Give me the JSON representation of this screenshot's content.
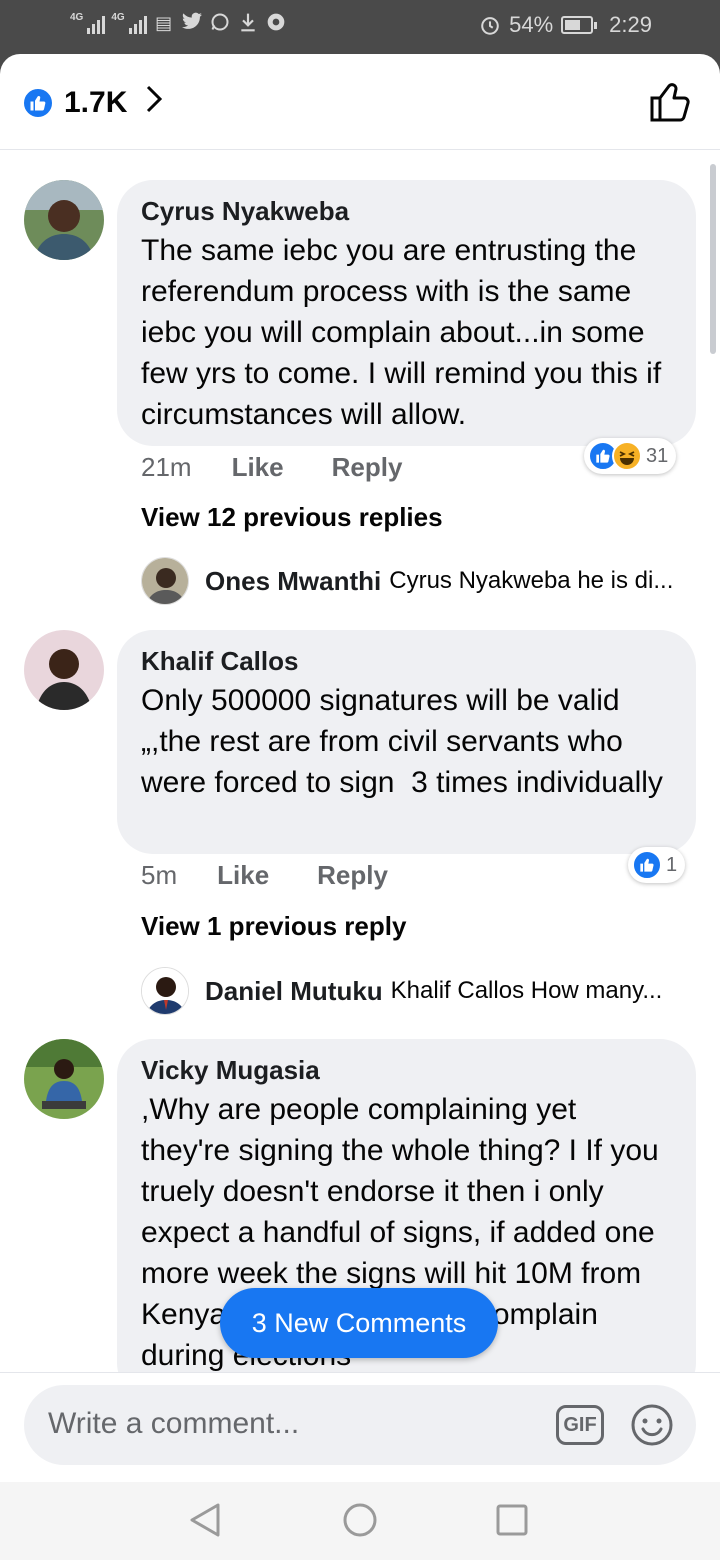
{
  "status_bar": {
    "network_1": "4G",
    "network_2": "4G",
    "battery": "54%",
    "time": "2:29"
  },
  "header": {
    "reaction_count": "1.7K"
  },
  "comments": [
    {
      "author": "Cyrus Nyakweba",
      "text": "The same iebc you are entrusting the referendum process with is the same iebc you will complain about...in some few yrs to come. I will remind you this if circumstances will allow.",
      "time": "21m",
      "like_label": "Like",
      "reply_label": "Reply",
      "reaction_count": "31",
      "view_replies": "View 12 previous replies",
      "reply_author": "Ones Mwanthi",
      "reply_preview": "Cyrus Nyakweba he is di..."
    },
    {
      "author": "Khalif Callos",
      "text": "Only 500000 signatures will be valid  „,the rest are from civil servants who were forced to sign  3 times individually",
      "time": "5m",
      "like_label": "Like",
      "reply_label": "Reply",
      "reaction_count": "1",
      "view_replies": "View 1 previous reply",
      "reply_author": "Daniel Mutuku",
      "reply_preview": "Khalif Callos How many..."
    },
    {
      "author": "Vicky Mugasia",
      "text": ",Why are people complaining yet they're signing the whole thing? I If you truely doesn't endorse it then i only expect a handful of signs, if added one more week the signs will hit 10M from Kenyans , this is how we complain during elections"
    }
  ],
  "new_comments_label": "3 New Comments",
  "composer": {
    "placeholder": "Write a comment...",
    "gif_label": "GIF"
  },
  "colors": {
    "accent": "#1877f2",
    "bubble": "#eff0f3",
    "secondary_text": "#65676b"
  }
}
